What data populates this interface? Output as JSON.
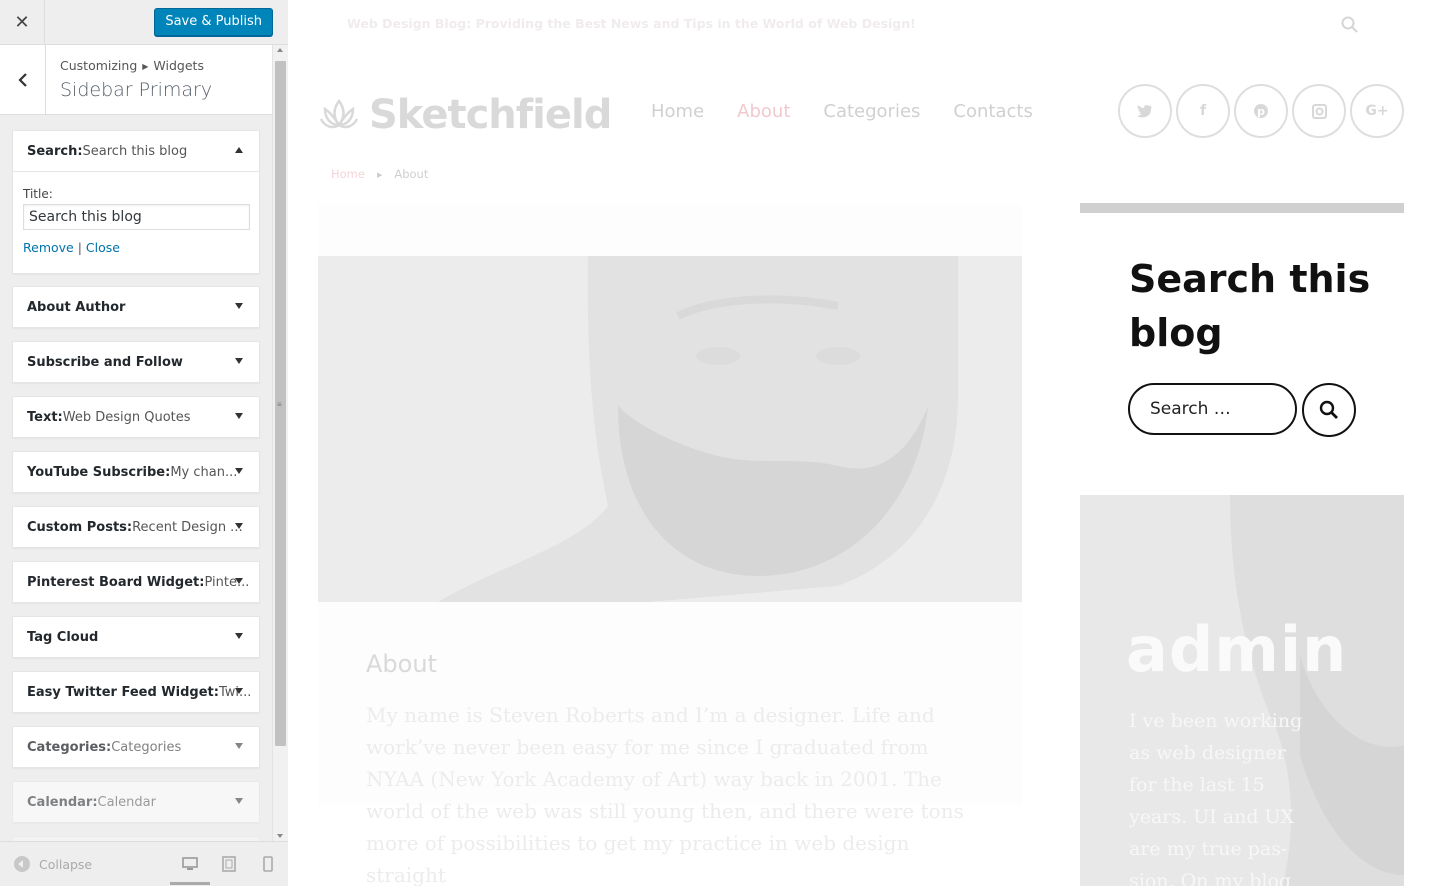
{
  "customizer": {
    "close_symbol": "✕",
    "save_label": "Save & Publish",
    "breadcrumb": {
      "parent": "Customizing",
      "child": "Widgets"
    },
    "section_title": "Sidebar Primary",
    "back_symbol": "‹",
    "widgets": [
      {
        "name": "Search:",
        "sub": " Search this blog",
        "expanded": true
      },
      {
        "name": "About Author",
        "sub": ""
      },
      {
        "name": "Subscribe and Follow",
        "sub": ""
      },
      {
        "name": "Text:",
        "sub": " Web Design Quotes"
      },
      {
        "name": "YouTube Subscribe:",
        "sub": " My chan..."
      },
      {
        "name": "Custom Posts:",
        "sub": " Recent Design ..."
      },
      {
        "name": "Pinterest Board Widget:",
        "sub": " Pinte..."
      },
      {
        "name": "Tag Cloud",
        "sub": ""
      },
      {
        "name": "Easy Twitter Feed Widget:",
        "sub": " Twi..."
      },
      {
        "name": "Categories:",
        "sub": " Categories"
      },
      {
        "name": "Calendar:",
        "sub": " Calendar"
      }
    ],
    "search_widget_form": {
      "title_label": "Title:",
      "title_value": "Search this blog",
      "remove_label": "Remove",
      "separator": "|",
      "close_label": "Close"
    },
    "footer": {
      "collapse_label": "Collapse",
      "devices": [
        "desktop-icon",
        "tablet-icon",
        "mobile-icon"
      ]
    },
    "accent_color": "#0085ba"
  },
  "preview": {
    "tagline": "Web Design Blog: Providing the Best News and Tips in the World of Web Design!",
    "logo_text": "Sketchfield",
    "nav": [
      {
        "label": "Home",
        "active": false
      },
      {
        "label": "About",
        "active": true
      },
      {
        "label": "Categories",
        "active": false
      },
      {
        "label": "Contacts",
        "active": false
      }
    ],
    "social": [
      "twitter-icon",
      "facebook-icon",
      "pinterest-icon",
      "instagram-icon",
      "google-plus-icon"
    ],
    "social_labels": {
      "twitter": "t",
      "facebook": "f",
      "pinterest": "p",
      "instagram": "◻",
      "googleplus": "G+"
    },
    "breadcrumb": {
      "home": "Home",
      "current": "About"
    },
    "article": {
      "title": "About",
      "body": "My name is Steven Roberts and I’m a designer. Life and work’ve never been easy for me since I graduated from NYAA (New York Academy of Art) way back in 2001. The world of the web was still young then, and there were tons more of possibilities to get my practice in web design straight"
    },
    "sidebar": {
      "search_title": "Search this blog",
      "search_placeholder": "Search …",
      "author_name": "admin",
      "author_bio": "I ve been working as web designer for the last 15 years. UI and UX are my true pas-sion. On my blog"
    }
  }
}
